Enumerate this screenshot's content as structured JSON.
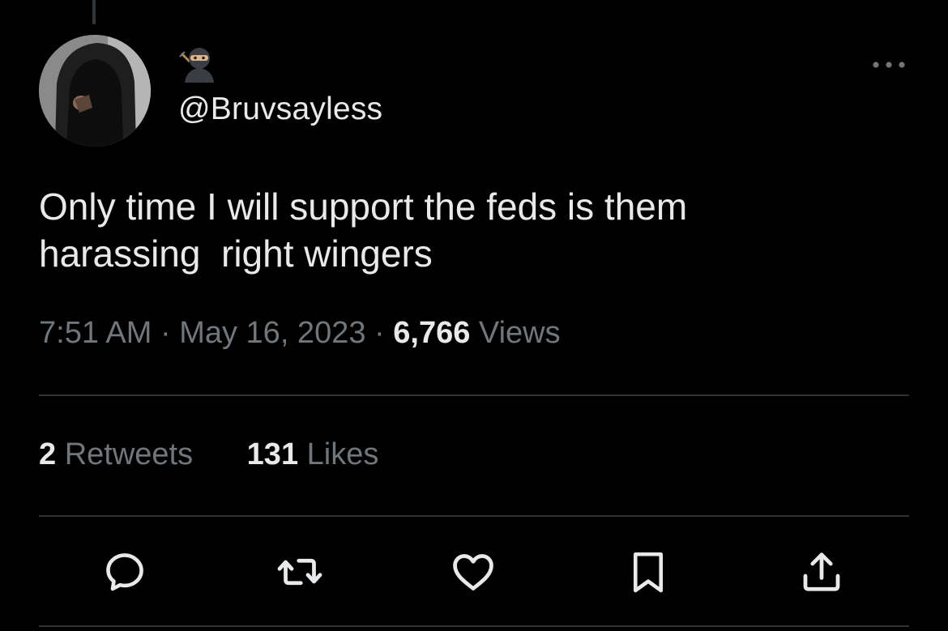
{
  "user": {
    "display_name_emoji": "🥷",
    "handle": "@Bruvsayless"
  },
  "tweet": {
    "text": "Only time I will support the feds is them\nharassing  right wingers",
    "time": "7:51 AM",
    "date": "May 16, 2023",
    "separator": "·",
    "views_count": "6,766",
    "views_label": "Views"
  },
  "stats": {
    "retweets_count": "2",
    "retweets_label": "Retweets",
    "likes_count": "131",
    "likes_label": "Likes"
  },
  "icons": {
    "more": "more-horizontal-icon",
    "reply": "reply-icon",
    "retweet": "retweet-icon",
    "like": "heart-icon",
    "bookmark": "bookmark-icon",
    "share": "share-icon"
  },
  "colors": {
    "background": "#000000",
    "primary_text": "#e7e9ea",
    "secondary_text": "#71767b",
    "divider": "#2f3336"
  }
}
